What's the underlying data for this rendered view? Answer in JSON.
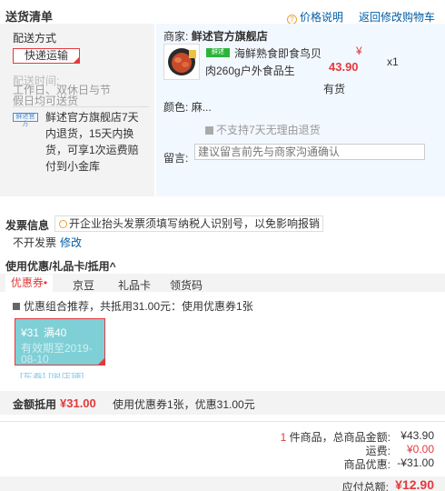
{
  "header": {
    "title": "送货清单",
    "price_info": "价格说明",
    "back_cart": "返回修改购物车"
  },
  "shipping": {
    "label": "配送方式",
    "method": "快递运输",
    "delivery_label": "配送时间:",
    "delivery_text": "工作日、双休日与节假日均可送货",
    "store_logo": "鲜述官方",
    "desc": "鲜述官方旗舰店7天内退货，15天内换货，可享1次运费赔付到小金库"
  },
  "product": {
    "merchant_label": "商家:",
    "merchant_name": "鲜述官方旗舰店",
    "badge": "鲜述",
    "name": "海鲜熟食即食鸟贝肉260g户外食品生",
    "currency": "¥",
    "price": "43.90",
    "qty": "x1",
    "stock": "有货",
    "color_label": "颜色:",
    "color_value": "麻...",
    "return_policy": "不支持7天无理由退货",
    "remark_label": "留言:",
    "remark_placeholder": "建议留言前先与商家沟通确认"
  },
  "invoice": {
    "title": "发票信息",
    "notice": "开企业抬头发票须填写纳税人识别号，以免影响报销",
    "value": "不开发票",
    "edit": "修改"
  },
  "coupons": {
    "title": "使用优惠/礼品卡/抵用",
    "title_arrow": "^",
    "tabs": [
      "优惠券",
      "京豆",
      "礼品卡",
      "领货码"
    ],
    "active_tab_dot": "•",
    "combo_text": "优惠组合推荐，共抵用31.00元：使用优惠券1张",
    "card": {
      "amount": "¥31",
      "condition": "满40",
      "expiry": "有效期至2019-08-10"
    },
    "card_tag": "[东券] [限店铺]",
    "deduct_label": "金额抵用",
    "deduct_amount": "¥31.00",
    "deduct_desc": "使用优惠券1张，优惠31.00元"
  },
  "summary": {
    "count_num": "1",
    "count_text": "件商品，总商品金额:",
    "total": "¥43.90",
    "shipping_label": "运费:",
    "shipping_value": "¥0.00",
    "discount_label": "商品优惠:",
    "discount_value": "-¥31.00",
    "pay_label": "应付总额:",
    "pay_value": "¥12.90"
  },
  "colors": {
    "accent_red": "#e4393c",
    "link_blue": "#005ea7",
    "coupon_bg": "#7fcfd6",
    "product_bg": "#f2f8ff"
  }
}
